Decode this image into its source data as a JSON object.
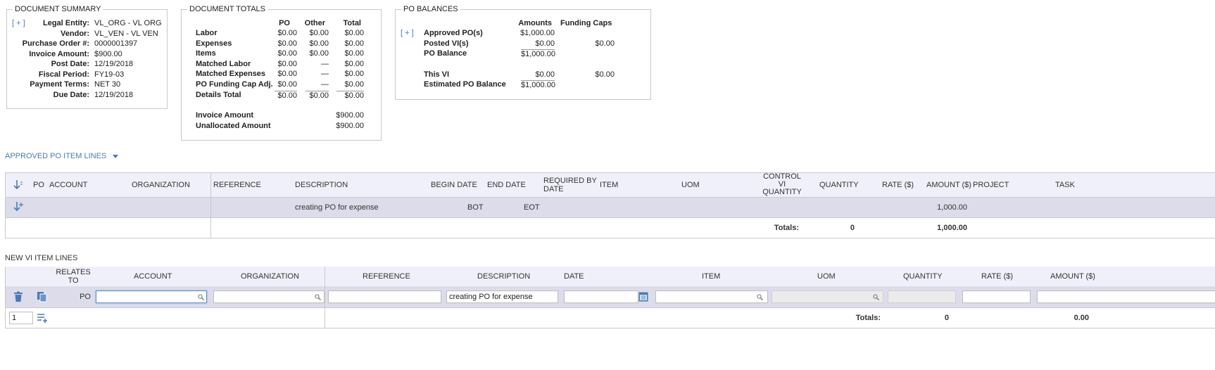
{
  "summary": {
    "legend": "DOCUMENT SUMMARY",
    "expand": "[ + ]",
    "rows": [
      {
        "label": "Legal Entity:",
        "value": "VL_ORG - VL ORG"
      },
      {
        "label": "Vendor:",
        "value": "VL_VEN - VL VEN"
      },
      {
        "label": "Purchase Order #:",
        "value": "0000001397"
      },
      {
        "label": "Invoice Amount:",
        "value": "$900.00"
      },
      {
        "label": "Post Date:",
        "value": "12/19/2018"
      },
      {
        "label": "Fiscal Period:",
        "value": "FY19-03"
      },
      {
        "label": "Payment Terms:",
        "value": "NET 30"
      },
      {
        "label": "Due Date:",
        "value": "12/19/2018"
      }
    ]
  },
  "totals": {
    "legend": "DOCUMENT TOTALS",
    "columns": [
      "PO",
      "Other",
      "Total"
    ],
    "rows": [
      {
        "label": "Labor",
        "po": "$0.00",
        "other": "$0.00",
        "total": "$0.00"
      },
      {
        "label": "Expenses",
        "po": "$0.00",
        "other": "$0.00",
        "total": "$0.00"
      },
      {
        "label": "Items",
        "po": "$0.00",
        "other": "$0.00",
        "total": "$0.00"
      },
      {
        "label": "Matched Labor",
        "po": "$0.00",
        "other": "—",
        "total": "$0.00"
      },
      {
        "label": "Matched Expenses",
        "po": "$0.00",
        "other": "—",
        "total": "$0.00"
      },
      {
        "label": "PO Funding Cap Adj.",
        "po": "$0.00",
        "other": "—",
        "total": "$0.00"
      },
      {
        "label": "Details Total",
        "po": "$0.00",
        "other": "$0.00",
        "total": "$0.00"
      }
    ],
    "invoice_amount_label": "Invoice Amount",
    "invoice_amount": "$900.00",
    "unallocated_label": "Unallocated Amount",
    "unallocated": "$900.00"
  },
  "balances": {
    "legend": "PO BALANCES",
    "expand": "[ + ]",
    "col_amounts": "Amounts",
    "col_caps": "Funding Caps",
    "approved_label": "Approved PO(s)",
    "approved": "$1,000.00",
    "posted_label": "Posted VI(s)",
    "posted": "$0.00",
    "posted_cap": "$0.00",
    "balance_label": "PO Balance",
    "balance": "$1,000.00",
    "this_label": "This VI",
    "this_vi": "$0.00",
    "this_cap": "$0.00",
    "est_label": "Estimated PO Balance",
    "est": "$1,000.00"
  },
  "approved_section": {
    "title": "APPROVED PO ITEM LINES",
    "headers": {
      "po": "PO",
      "account": "ACCOUNT",
      "organization": "ORGANIZATION",
      "reference": "REFERENCE",
      "description": "DESCRIPTION",
      "begin_date": "BEGIN DATE",
      "end_date": "END DATE",
      "required_by_1": "REQUIRED BY",
      "required_by_2": "DATE",
      "item": "ITEM",
      "uom": "UOM",
      "control_1": "CONTROL",
      "control_2": "VI",
      "control_3": "QUANTITY",
      "quantity": "QUANTITY",
      "rate": "RATE ($)",
      "amount": "AMOUNT ($)",
      "project": "PROJECT",
      "task": "TASK"
    },
    "row": {
      "description": "creating PO for expense",
      "begin_date": "BOT",
      "end_date": "EOT",
      "amount": "1,000.00"
    },
    "totals_label": "Totals:",
    "totals_quantity": "0",
    "totals_amount": "1,000.00"
  },
  "new_section": {
    "title": "NEW VI ITEM LINES",
    "headers": {
      "relates_1": "RELATES",
      "relates_2": "TO",
      "account": "ACCOUNT",
      "organization": "ORGANIZATION",
      "reference": "REFERENCE",
      "description": "DESCRIPTION",
      "date": "DATE",
      "item": "ITEM",
      "uom": "UOM",
      "quantity": "QUANTITY",
      "rate": "RATE ($)",
      "amount": "AMOUNT ($)"
    },
    "row": {
      "relates_to": "PO",
      "description": "creating PO for expense",
      "account": "",
      "organization": "",
      "reference": "",
      "date": "",
      "item": "",
      "uom": "",
      "quantity": "",
      "rate": "",
      "amount": ""
    },
    "add_count": "1",
    "totals_label": "Totals:",
    "totals_quantity": "0",
    "totals_amount": "0.00"
  },
  "colors": {
    "accent": "#4a7ab6",
    "header_bg": "#f0f0fa",
    "row_selected": "#dcdcea"
  }
}
